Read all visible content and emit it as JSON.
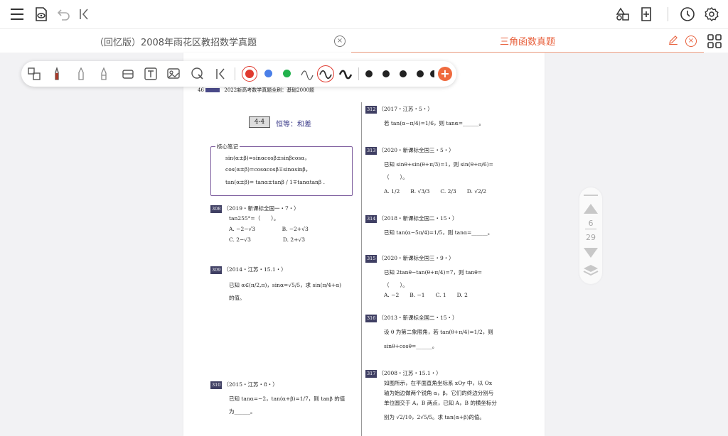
{
  "topbar": {
    "icons": [
      "menu-icon",
      "eye-document-icon",
      "undo-icon",
      "collapse-left-icon",
      "shapes-icon",
      "add-page-icon",
      "history-icon",
      "settings-icon"
    ]
  },
  "tabs": [
    {
      "label": "（回忆版）2008年雨花区教招数学真题",
      "active": false
    },
    {
      "label": "三角函数真题",
      "active": true
    }
  ],
  "toolbar": {
    "tools": [
      "lasso-select-icon",
      "pen-icon",
      "pencil-icon",
      "highlighter-icon",
      "eraser-icon",
      "text-box-icon",
      "image-icon",
      "shape-select-icon",
      "collapse-icon"
    ],
    "colors": [
      "#e03a2f",
      "#4a7fe8",
      "#22b24c"
    ],
    "strokes": [
      "#555555",
      "#e03a2f",
      "#222222"
    ],
    "sizes": [
      "#222222",
      "#222222",
      "#222222",
      "#222222",
      "#222222"
    ],
    "add_color": "#ef6a3e"
  },
  "pagenav": {
    "current": "6",
    "total": "29"
  },
  "document": {
    "page_number": "46",
    "header_title": "2022新高考数学真题全刷：基础2000题",
    "section_number": "4-4",
    "section_title": "恒等：和差",
    "note_title": "核心笔记",
    "note_lines": [
      "sin(α±β)=sinαcosβ±sinβcosα，",
      "cos(α±β)=cosαcosβ∓sinαsinβ，",
      "tan(α±β)= tanα±tanβ / 1∓tanαtanβ ."
    ],
    "left_questions": [
      {
        "id": "308",
        "source": "（2019・新课标全国一・7・）",
        "lines": [
          "tan255°=（　　）。",
          "A. −2−√3　　　　　B. −2+√3",
          "C. 2−√3　　　　　　D. 2+√3"
        ]
      },
      {
        "id": "309",
        "source": "（2014・江苏・15.1・）",
        "lines": [
          "已知 α∈(π/2,π)，sinα=√5/5，求 sin(π/4+α)",
          "的值。"
        ]
      },
      {
        "id": "310",
        "source": "（2015・江苏・8・）",
        "lines": [
          "已知 tanα=−2，tan(α+β)=1/7，则 tanβ 的值",
          "为______。"
        ]
      }
    ],
    "right_questions": [
      {
        "id": "312",
        "source": "（2017・江苏・5・）",
        "lines": [
          "若 tan(α−π/4)=1/6，则 tanα=______。"
        ]
      },
      {
        "id": "313",
        "source": "（2020・新课标全国三・5・）",
        "lines": [
          "已知 sinθ+sin(θ+π/3)=1，则 sin(θ+π/6)=",
          "（　　）。",
          "A. 1/2　　B. √3/3　　C. 2/3　　D. √2/2"
        ]
      },
      {
        "id": "314",
        "source": "（2018・新课标全国二・15・）",
        "lines": [
          "已知 tan(α−5π/4)=1/5，则 tanα=______。"
        ]
      },
      {
        "id": "315",
        "source": "（2020・新课标全国三・9・）",
        "lines": [
          "已知 2tanθ−tan(θ+π/4)=7，则 tanθ=",
          "（　　）。",
          "A. −2　　B. −1　　C. 1　　D. 2"
        ]
      },
      {
        "id": "316",
        "source": "（2013・新课标全国二・15・）",
        "lines": [
          "设 θ 为第二象限角，若 tan(θ+π/4)=1/2，则",
          "sinθ+cosθ=______。"
        ]
      },
      {
        "id": "317",
        "source": "（2008・江苏・15.1・）",
        "lines": [
          "如图所示，在平面直角坐标系 xOy 中，以 Ox",
          "轴为始边做两个锐角 α，β，它们的终边分别与",
          "单位圆交于 A，B 两点，已知 A，B 的横坐标分",
          "别为 √2/10，2√5/5。求 tan(α+β)的值。"
        ]
      }
    ]
  }
}
